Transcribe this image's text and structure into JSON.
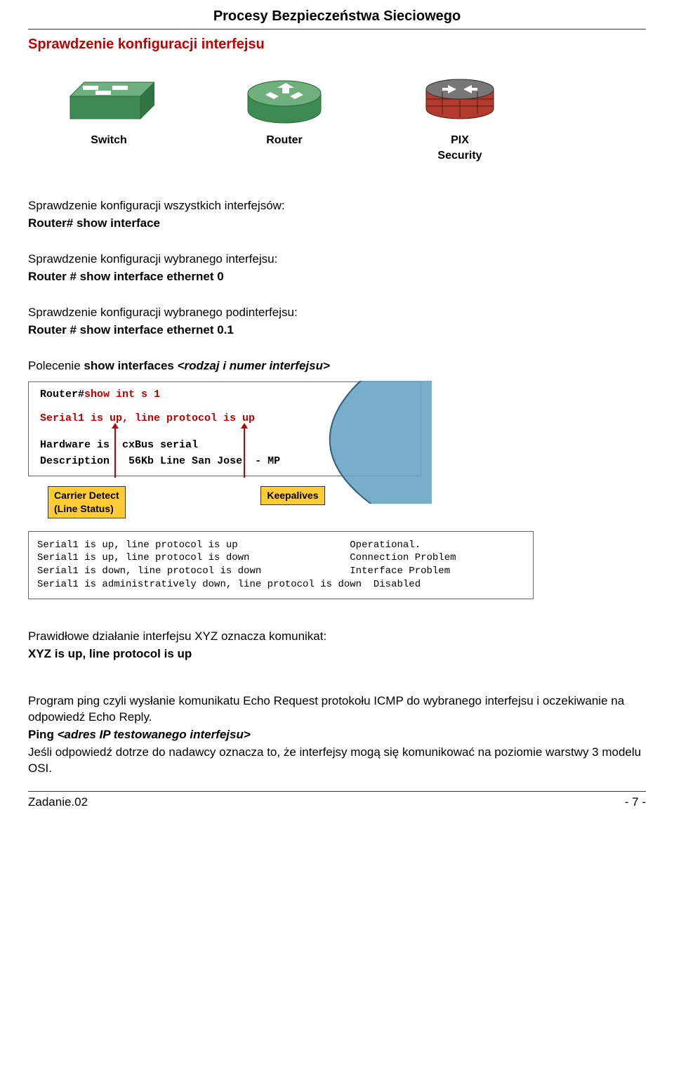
{
  "header": "Procesy Bezpieczeństwa Sieciowego",
  "section_title": "Sprawdzenie konfiguracji interfejsu",
  "devices": {
    "switch": "Switch",
    "router": "Router",
    "pix1": "PIX",
    "pix2": "Security"
  },
  "t1a": "Sprawdzenie konfiguracji wszystkich interfejsów:",
  "t1b": "Router# show interface",
  "t2a": "Sprawdzenie konfiguracji wybranego interfejsu:",
  "t2b": "Router # show interface ethernet 0",
  "t3a": "Sprawdzenie konfiguracji wybranego podinterfejsu:",
  "t3b": "Router # show interface ethernet 0.1",
  "cmd_intro_a": "Polecenie ",
  "cmd_intro_b": "show interfaces ",
  "cmd_intro_c": "<rodzaj i numer interfejsu>",
  "term": {
    "prompt": "Router#",
    "cmd": "show int s 1",
    "status": "Serial1 is up, line protocol is up",
    "hw1a": "Hardware is",
    "hw1b": "cxBus serial",
    "hw2a": "Description",
    "hw2b": "56Kb Line San Jose",
    "hw2c": "- MP"
  },
  "badge1a": "Carrier Detect",
  "badge1b": "(Line Status)",
  "badge2": "Keepalives",
  "status_table": "Serial1 is up, line protocol is up                   Operational.\nSerial1 is up, line protocol is down                 Connection Problem\nSerial1 is down, line protocol is down               Interface Problem\nSerial1 is administratively down, line protocol is down  Disabled",
  "ok_intro": "Prawidłowe działanie interfejsu XYZ oznacza komunikat:",
  "ok_msg": "XYZ is up, line protocol is up",
  "ping_p": "Program ping czyli wysłanie komunikatu Echo Request protokołu ICMP do wybranego interfejsu i oczekiwanie na odpowiedź Echo Reply.",
  "ping_cmd_a": "Ping ",
  "ping_cmd_b": "<adres IP testowanego interfejsu>",
  "ping_reply": "Jeśli odpowiedź dotrze do nadawcy oznacza to, że interfejsy mogą się komunikować na poziomie warstwy 3 modelu OSI.",
  "footer_left": "Zadanie.02",
  "footer_right": "- 7 -"
}
